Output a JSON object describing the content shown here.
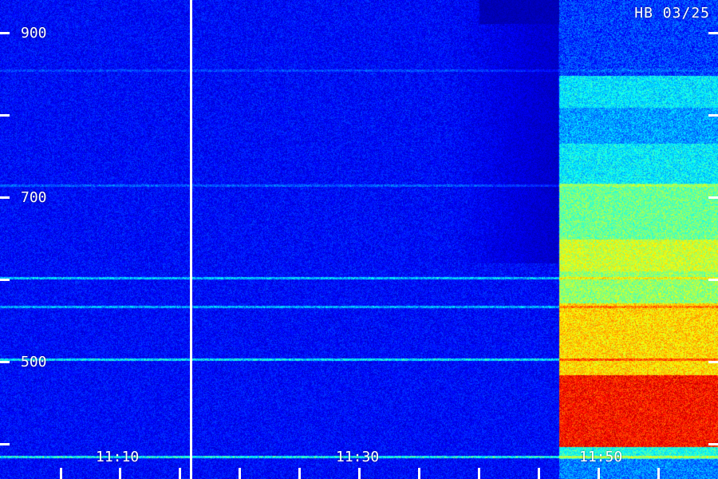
{
  "header": {
    "station_tag": "HB 03/25"
  },
  "y_axis": {
    "tick_labels": [
      "900",
      "700",
      "500"
    ]
  },
  "x_axis": {
    "tick_labels": [
      "11:10",
      "11:30",
      "11:50"
    ]
  },
  "colors": {
    "background_noise": "#1a1aa0",
    "low": "#0b0b55",
    "mid": "#00ffff",
    "high": "#00ff40",
    "peak": "#ff2000",
    "text": "#ffffff"
  }
}
